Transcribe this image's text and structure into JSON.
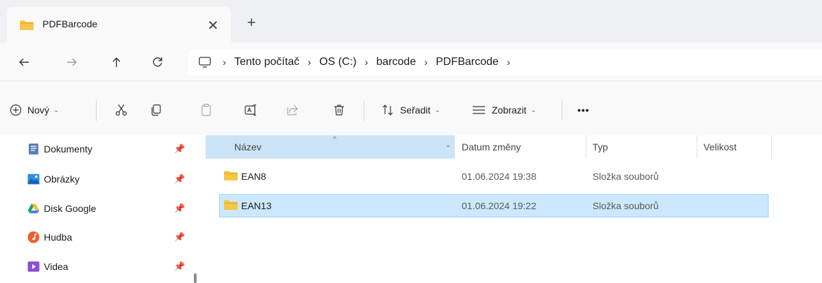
{
  "tab": {
    "title": "PDFBarcode",
    "close_glyph": "✕",
    "add_glyph": "+"
  },
  "colors": {
    "folder": "#f4c64a",
    "folder_dark": "#e8ad28",
    "selection": "#cce8ff",
    "selection_border": "#99d1ff",
    "header_selected": "#cce4f7"
  },
  "nav": {
    "back_icon": "arrow-left-icon",
    "forward_icon": "arrow-right-icon",
    "up_icon": "arrow-up-icon",
    "refresh_icon": "refresh-icon"
  },
  "breadcrumb": [
    "Tento počítač",
    "OS (C:)",
    "barcode",
    "PDFBarcode"
  ],
  "toolbar": {
    "new_label": "Nový",
    "sort_label": "Seřadit",
    "view_label": "Zobrazit",
    "more_label": "•••"
  },
  "sidebar": {
    "items": [
      {
        "label": "Dokumenty",
        "icon": "documents-icon"
      },
      {
        "label": "Obrázky",
        "icon": "pictures-icon"
      },
      {
        "label": "Disk Google",
        "icon": "google-drive-icon"
      },
      {
        "label": "Hudba",
        "icon": "music-icon"
      },
      {
        "label": "Videa",
        "icon": "videos-icon"
      }
    ]
  },
  "columns": {
    "name": "Název",
    "date": "Datum změny",
    "type": "Typ",
    "size": "Velikost"
  },
  "rows": [
    {
      "name": "EAN8",
      "date": "01.06.2024 19:38",
      "type": "Složka souborů",
      "size": ""
    },
    {
      "name": "EAN13",
      "date": "01.06.2024 19:22",
      "type": "Složka souborů",
      "size": ""
    }
  ]
}
